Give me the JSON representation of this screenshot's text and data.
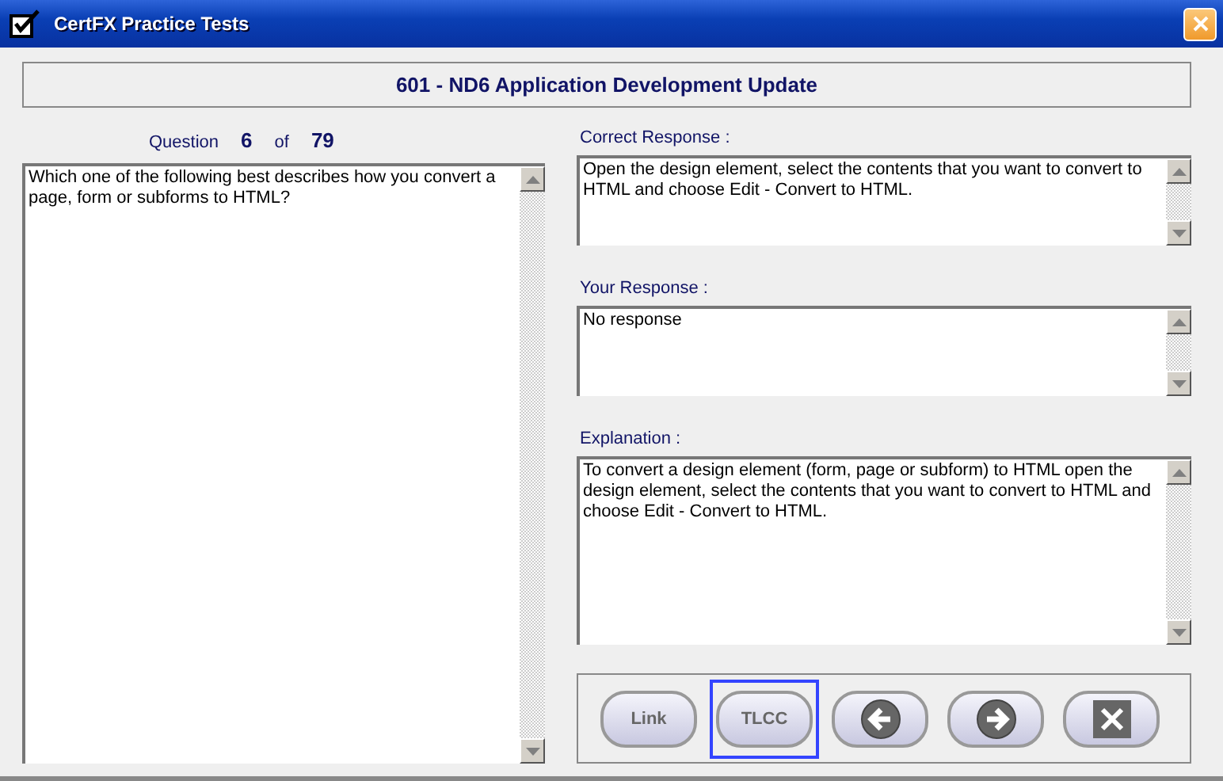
{
  "window": {
    "title": "CertFX Practice Tests"
  },
  "exam_title": "601 - ND6 Application Development Update",
  "question_counter": {
    "label": "Question",
    "current": "6",
    "separator": "of",
    "total": "79"
  },
  "question": {
    "text": "Which one of the following best describes how you convert a page, form or subforms to HTML?"
  },
  "fields": [
    {
      "label": "Correct Response :",
      "text": "Open the design element, select the contents that you want to convert to HTML and choose Edit - Convert to HTML."
    },
    {
      "label": "Your Response :",
      "text": "No response"
    },
    {
      "label": "Explanation :",
      "text": "To convert a design element (form, page or subform) to HTML open the design element, select the contents that you want to convert to HTML and choose Edit - Convert to HTML."
    }
  ],
  "buttons": [
    {
      "kind": "text",
      "label": "Link",
      "focused": false
    },
    {
      "kind": "text",
      "label": "TLCC",
      "focused": true
    },
    {
      "kind": "back",
      "focused": false
    },
    {
      "kind": "forward",
      "focused": false
    },
    {
      "kind": "close",
      "focused": false
    }
  ]
}
